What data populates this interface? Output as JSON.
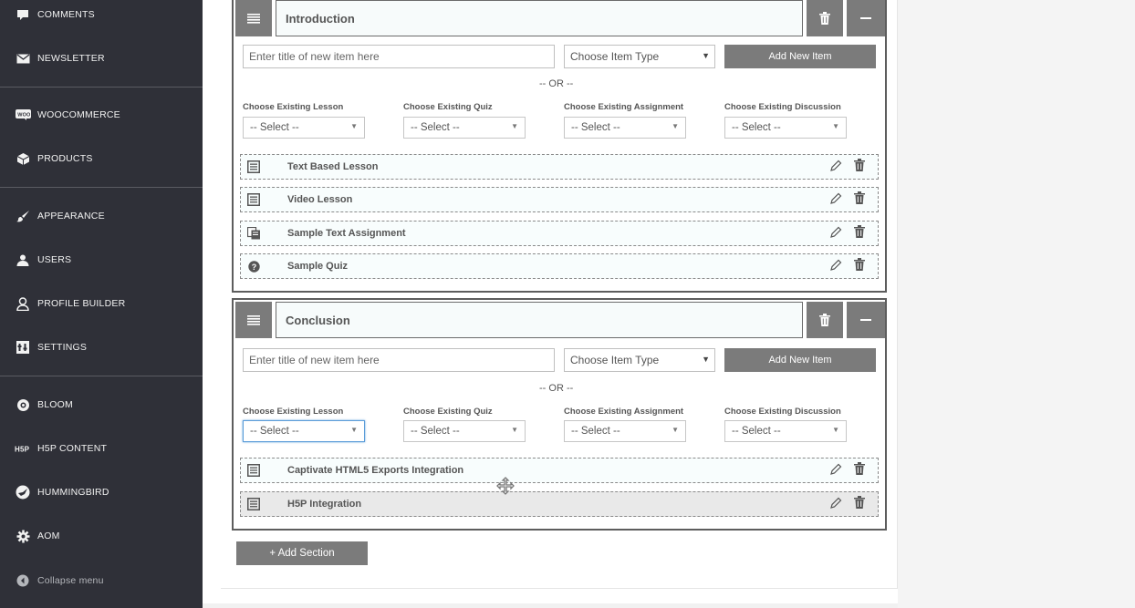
{
  "sidebar": {
    "items": [
      {
        "label": "Comments",
        "icon": "comment-icon"
      },
      {
        "label": "Newsletter",
        "icon": "envelope-icon"
      },
      {
        "label": "WooCommerce",
        "icon": "woocommerce-icon"
      },
      {
        "label": "Products",
        "icon": "cube-icon"
      },
      {
        "label": "Appearance",
        "icon": "paintbrush-icon"
      },
      {
        "label": "Users",
        "icon": "user-icon"
      },
      {
        "label": "Profile Builder",
        "icon": "profile-icon"
      },
      {
        "label": "Settings",
        "icon": "settings-icon"
      },
      {
        "label": "Bloom",
        "icon": "bloom-icon"
      },
      {
        "label": "H5P Content",
        "icon": "h5p-icon"
      },
      {
        "label": "Hummingbird",
        "icon": "hummingbird-icon"
      },
      {
        "label": "AOM",
        "icon": "gear-icon"
      },
      {
        "label": "Collapse menu",
        "icon": "collapse-icon"
      }
    ],
    "colors": {
      "background": "#2f3038",
      "text": "#f2f2f2"
    }
  },
  "sections": [
    {
      "title": "Introduction",
      "new_item_placeholder": "Enter title of new item here",
      "item_type": "Choose Item Type",
      "add_button": "Add New Item",
      "or_text": "-- OR --",
      "choosers": [
        {
          "label": "Choose Existing Lesson",
          "value": "-- Select --"
        },
        {
          "label": "Choose Existing Quiz",
          "value": "-- Select --"
        },
        {
          "label": "Choose Existing Assignment",
          "value": "-- Select --"
        },
        {
          "label": "Choose Existing Discussion",
          "value": "-- Select --"
        }
      ],
      "items": [
        {
          "label": "Text Based Lesson",
          "icon": "lesson-icon"
        },
        {
          "label": "Video Lesson",
          "icon": "lesson-icon"
        },
        {
          "label": "Sample Text Assignment",
          "icon": "assignment-icon"
        },
        {
          "label": "Sample Quiz",
          "icon": "quiz-icon"
        }
      ]
    },
    {
      "title": "Conclusion",
      "new_item_placeholder": "Enter title of new item here",
      "item_type": "Choose Item Type",
      "add_button": "Add New Item",
      "or_text": "-- OR --",
      "choosers": [
        {
          "label": "Choose Existing Lesson",
          "value": "-- Select --"
        },
        {
          "label": "Choose Existing Quiz",
          "value": "-- Select --"
        },
        {
          "label": "Choose Existing Assignment",
          "value": "-- Select --"
        },
        {
          "label": "Choose Existing Discussion",
          "value": "-- Select --"
        }
      ],
      "items": [
        {
          "label": "Captivate HTML5 Exports Integration",
          "icon": "lesson-icon"
        },
        {
          "label": "H5P Integration",
          "icon": "lesson-icon"
        }
      ]
    }
  ],
  "add_section_label": "+ Add Section",
  "colors": {
    "accent": "#7b7b7b",
    "border": "#5d5d5d",
    "focus": "#5b9dd9"
  }
}
